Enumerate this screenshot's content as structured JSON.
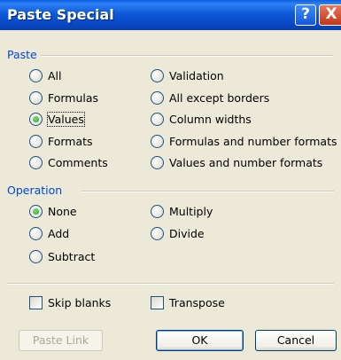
{
  "dialog": {
    "title": "Paste Special",
    "help_glyph": "?",
    "close_glyph": "X"
  },
  "paste": {
    "label": "Paste",
    "options": [
      {
        "label": "All",
        "selected": false
      },
      {
        "label": "Formulas",
        "selected": false
      },
      {
        "label": "Values",
        "selected": true
      },
      {
        "label": "Formats",
        "selected": false
      },
      {
        "label": "Comments",
        "selected": false
      },
      {
        "label": "Validation",
        "selected": false
      },
      {
        "label": "All except borders",
        "selected": false
      },
      {
        "label": "Column widths",
        "selected": false
      },
      {
        "label": "Formulas and number formats",
        "selected": false
      },
      {
        "label": "Values and number formats",
        "selected": false
      }
    ]
  },
  "operation": {
    "label": "Operation",
    "options": [
      {
        "label": "None",
        "selected": true
      },
      {
        "label": "Add",
        "selected": false
      },
      {
        "label": "Subtract",
        "selected": false
      },
      {
        "label": "Multiply",
        "selected": false
      },
      {
        "label": "Divide",
        "selected": false
      }
    ]
  },
  "checkboxes": {
    "skip_blanks": {
      "label": "Skip blanks",
      "checked": false
    },
    "transpose": {
      "label": "Transpose",
      "checked": false
    }
  },
  "buttons": {
    "paste_link": "Paste Link",
    "ok": "OK",
    "cancel": "Cancel"
  }
}
